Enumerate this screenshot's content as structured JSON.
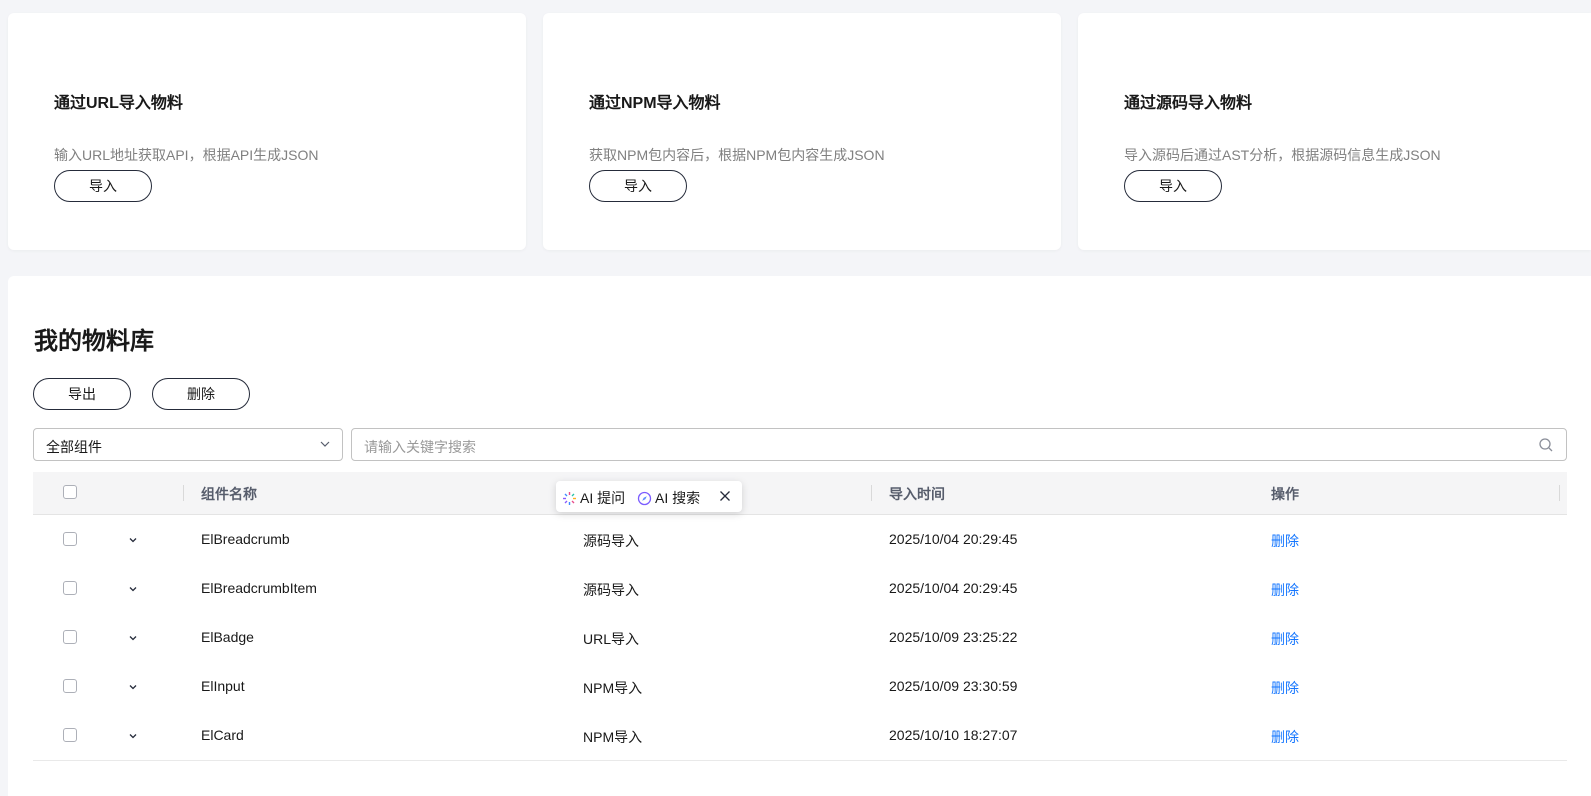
{
  "import_cards": [
    {
      "title": "通过URL导入物料",
      "desc": "输入URL地址获取API，根据API生成JSON",
      "button": "导入"
    },
    {
      "title": "通过NPM导入物料",
      "desc": "获取NPM包内容后，根据NPM包内容生成JSON",
      "button": "导入"
    },
    {
      "title": "通过源码导入物料",
      "desc": "导入源码后通过AST分析，根据源码信息生成JSON",
      "button": "导入"
    }
  ],
  "library": {
    "title": "我的物料库",
    "export_label": "导出",
    "delete_label": "删除",
    "filter_value": "全部组件",
    "search_placeholder": "请输入关键字搜索",
    "columns": {
      "name": "组件名称",
      "time": "导入时间",
      "action": "操作"
    },
    "rows": [
      {
        "name": "ElBreadcrumb",
        "source": "源码导入",
        "time": "2025/10/04 20:29:45",
        "action": "删除"
      },
      {
        "name": "ElBreadcrumbItem",
        "source": "源码导入",
        "time": "2025/10/04 20:29:45",
        "action": "删除"
      },
      {
        "name": "ElBadge",
        "source": "URL导入",
        "time": "2025/10/09 23:25:22",
        "action": "删除"
      },
      {
        "name": "ElInput",
        "source": "NPM导入",
        "time": "2025/10/09 23:30:59",
        "action": "删除"
      },
      {
        "name": "ElCard",
        "source": "NPM导入",
        "time": "2025/10/10 18:27:07",
        "action": "删除"
      }
    ]
  },
  "ai_popup": {
    "ask_label": "AI 提问",
    "search_label": "AI 搜索"
  },
  "colors": {
    "accent": "#1476ff",
    "page_bg": "#f4f5f8",
    "header_bg": "#f5f5f6"
  }
}
